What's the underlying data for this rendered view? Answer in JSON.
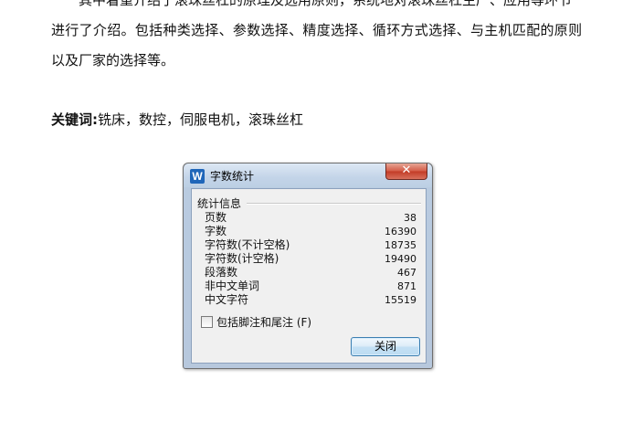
{
  "document": {
    "line1": "其中着重介绍了滚珠丝杠的原理及选用原则，系统地对滚珠丝杠生产、应用等环节",
    "line2": "进行了介绍。包括种类选择、参数选择、精度选择、循环方式选择、与主机匹配的原则",
    "line3": "以及厂家的选择等。",
    "keywords_label": "关键词:",
    "keywords_text": "铣床，数控，伺服电机，滚珠丝杠"
  },
  "dialog": {
    "title": "字数统计",
    "app_icon": "W",
    "close_glyph": "✕",
    "group_label": "统计信息",
    "stats": [
      {
        "label": "页数",
        "value": "38"
      },
      {
        "label": "字数",
        "value": "16390"
      },
      {
        "label": "字符数(不计空格)",
        "value": "18735"
      },
      {
        "label": "字符数(计空格)",
        "value": "19490"
      },
      {
        "label": "段落数",
        "value": "467"
      },
      {
        "label": "非中文单词",
        "value": "871"
      },
      {
        "label": "中文字符",
        "value": "15519"
      }
    ],
    "checkbox_label": "包括脚注和尾注 (F)",
    "checkbox_checked": false,
    "close_button_label": "关闭"
  },
  "colors": {
    "dialog_frame": "#b9cbe0",
    "close_button_red": "#c23b26",
    "app_icon_blue": "#1f66b9"
  }
}
